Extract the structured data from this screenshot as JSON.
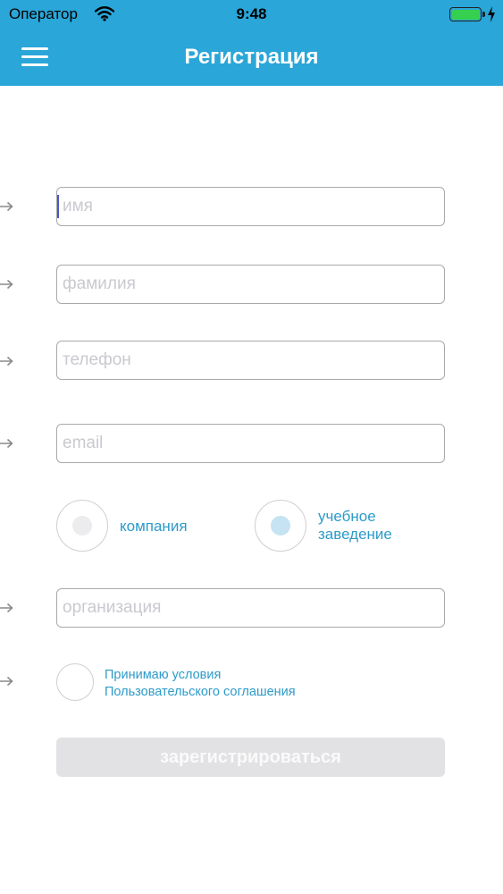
{
  "status_bar": {
    "carrier": "Оператор",
    "time": "9:48",
    "battery_level": 1.0,
    "battery_color": "#35d04f",
    "icons": [
      "wifi-icon",
      "battery-icon",
      "charging-bolt-icon"
    ]
  },
  "header": {
    "title": "Регистрация",
    "background": "#2aa6d8",
    "menu_icon": "hamburger-menu-icon"
  },
  "form": {
    "first_name": {
      "placeholder": "имя",
      "value": ""
    },
    "last_name": {
      "placeholder": "фамилия",
      "value": ""
    },
    "phone": {
      "placeholder": "телефон",
      "value": ""
    },
    "email": {
      "placeholder": "email",
      "value": ""
    },
    "org_type": {
      "options": [
        {
          "label": "компания",
          "selected": false
        },
        {
          "label": "учебное\nзаведение",
          "selected": true
        }
      ]
    },
    "organization": {
      "placeholder": "организация",
      "value": ""
    },
    "terms": {
      "label": "Принимаю условия\nПользовательского соглашения",
      "checked": false
    },
    "submit_label": "зарегистрироваться",
    "field_icon": "arrow-right-icon"
  },
  "colors": {
    "accent": "#2aa6d8",
    "link_text": "#2d9bc9",
    "selected_dot": "#c5e3f2",
    "unselected_dot": "#ececee",
    "disabled_button": "#e2e2e5"
  }
}
